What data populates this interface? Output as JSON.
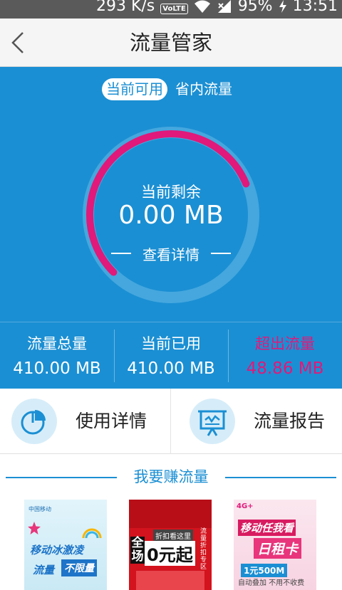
{
  "status_bar": {
    "speed": "293 K/s",
    "volte": "VoLTE",
    "battery": "95%",
    "time": "13:51"
  },
  "header": {
    "title": "流量管家"
  },
  "tabs": {
    "active": "当前可用",
    "inactive": "省内流量"
  },
  "gauge": {
    "label": "当前剩余",
    "value": "0.00 MB",
    "link": "查看详情",
    "fill_fraction": 0.75,
    "colors": {
      "arc": "#e0197a",
      "ring_bg": "#1b8fd3"
    }
  },
  "stats": [
    {
      "label": "流量总量",
      "value": "410.00 MB"
    },
    {
      "label": "当前已用",
      "value": "410.00 MB"
    },
    {
      "label": "超出流量",
      "value": "48.86 MB"
    }
  ],
  "actions": [
    {
      "label": "使用详情",
      "icon": "pie-chart-icon"
    },
    {
      "label": "流量报告",
      "icon": "report-board-icon"
    }
  ],
  "earn": {
    "title": "我要赚流量",
    "promos": [
      {
        "line1": "移动冰激凌",
        "line2a": "流量",
        "line2b": "不限量",
        "brand": "中国移动"
      },
      {
        "badge": "折扣看这里",
        "big1": "全场",
        "big2": "0元起",
        "side": "流量折扣专区"
      },
      {
        "tag": "4G+",
        "line1": "移动任我看",
        "line2": "日租卡",
        "line3": "1元500M",
        "line4": "自动叠加 不用不收费"
      }
    ]
  },
  "colors": {
    "primary": "#1b8fd3",
    "accent": "#e0197a"
  }
}
